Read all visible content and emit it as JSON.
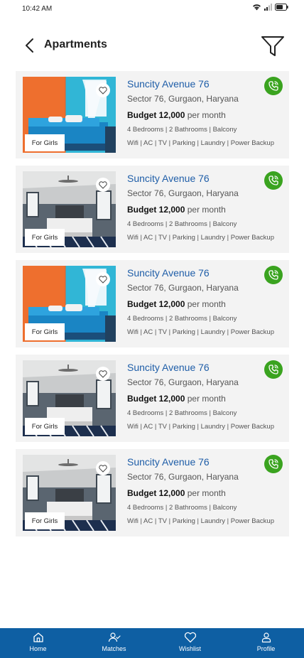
{
  "status_bar": {
    "time": "10:42 AM"
  },
  "header": {
    "title": "Apartments"
  },
  "listings": [
    {
      "image": "orange-blue-bedroom",
      "tag": "For Girls",
      "title": "Suncity Avenue 76",
      "address": "Sector 76, Gurgaon, Haryana",
      "budget_label": "Budget 12,000",
      "budget_unit": "per month",
      "rooms": "4 Bedrooms | 2 Bathrooms | Balcony",
      "amenities": "Wifi | AC | TV | Parking | Laundry | Power Backup"
    },
    {
      "image": "grey-bedroom",
      "tag": "For Girls",
      "title": "Suncity Avenue 76",
      "address": "Sector 76, Gurgaon, Haryana",
      "budget_label": "Budget 12,000",
      "budget_unit": "per month",
      "rooms": "4 Bedrooms | 2 Bathrooms | Balcony",
      "amenities": "Wifi | AC | TV | Parking | Laundry | Power Backup"
    },
    {
      "image": "orange-blue-bedroom",
      "tag": "For Girls",
      "title": "Suncity Avenue 76",
      "address": "Sector 76, Gurgaon, Haryana",
      "budget_label": "Budget 12,000",
      "budget_unit": "per month",
      "rooms": "4 Bedrooms | 2 Bathrooms | Balcony",
      "amenities": "Wifi | AC | TV | Parking | Laundry | Power Backup"
    },
    {
      "image": "grey-bedroom",
      "tag": "For Girls",
      "title": "Suncity Avenue 76",
      "address": "Sector 76, Gurgaon, Haryana",
      "budget_label": "Budget 12,000",
      "budget_unit": "per month",
      "rooms": "4 Bedrooms | 2 Bathrooms | Balcony",
      "amenities": "Wifi | AC | TV | Parking | Laundry | Power Backup"
    },
    {
      "image": "grey-bedroom",
      "tag": "For Girls",
      "title": "Suncity Avenue 76",
      "address": "Sector 76, Gurgaon, Haryana",
      "budget_label": "Budget 12,000",
      "budget_unit": "per month",
      "rooms": "4 Bedrooms | 2 Bathrooms | Balcony",
      "amenities": "Wifi | AC | TV | Parking | Laundry | Power Backup"
    }
  ],
  "bottom_nav": {
    "items": [
      {
        "label": "Home",
        "icon": "home-icon"
      },
      {
        "label": "Matches",
        "icon": "matches-icon"
      },
      {
        "label": "Wishlist",
        "icon": "heart-icon"
      },
      {
        "label": "Profile",
        "icon": "profile-icon"
      }
    ]
  },
  "colors": {
    "accent": "#1f5ea8",
    "nav_bg": "#0e5fa3",
    "call_green": "#3aa31f",
    "card_bg": "#f3f3f3"
  }
}
